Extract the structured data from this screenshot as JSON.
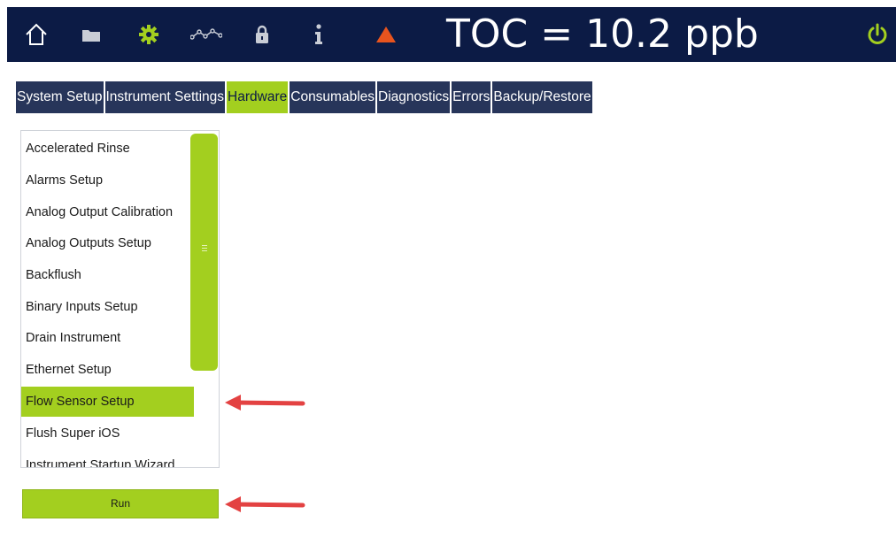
{
  "header": {
    "icons": [
      "home-icon",
      "folder-icon",
      "gear-icon",
      "trend-icon",
      "lock-icon",
      "info-icon",
      "warning-icon",
      "power-icon"
    ],
    "reading": "TOC = 10.2 ppb"
  },
  "tabs": [
    {
      "label": "System Setup",
      "active": false
    },
    {
      "label": "Instrument Settings",
      "active": false
    },
    {
      "label": "Hardware",
      "active": true
    },
    {
      "label": "Consumables",
      "active": false
    },
    {
      "label": "Diagnostics",
      "active": false
    },
    {
      "label": "Errors",
      "active": false
    },
    {
      "label": "Backup/Restore",
      "active": false
    }
  ],
  "list": {
    "items": [
      "Accelerated Rinse",
      "Alarms Setup",
      "Analog Output Calibration",
      "Analog Outputs Setup",
      "Backflush",
      "Binary Inputs Setup",
      "Drain Instrument",
      "Ethernet Setup",
      "Flow Sensor Setup",
      "Flush Super iOS",
      "Instrument Startup Wizard"
    ],
    "selected": "Flow Sensor Setup"
  },
  "run_button": "Run",
  "colors": {
    "header_bg": "#0c1b45",
    "tab_bg": "#27355a",
    "accent": "#a3cf1f",
    "warning": "#e8541e",
    "annotation_arrow": "#e34242"
  }
}
